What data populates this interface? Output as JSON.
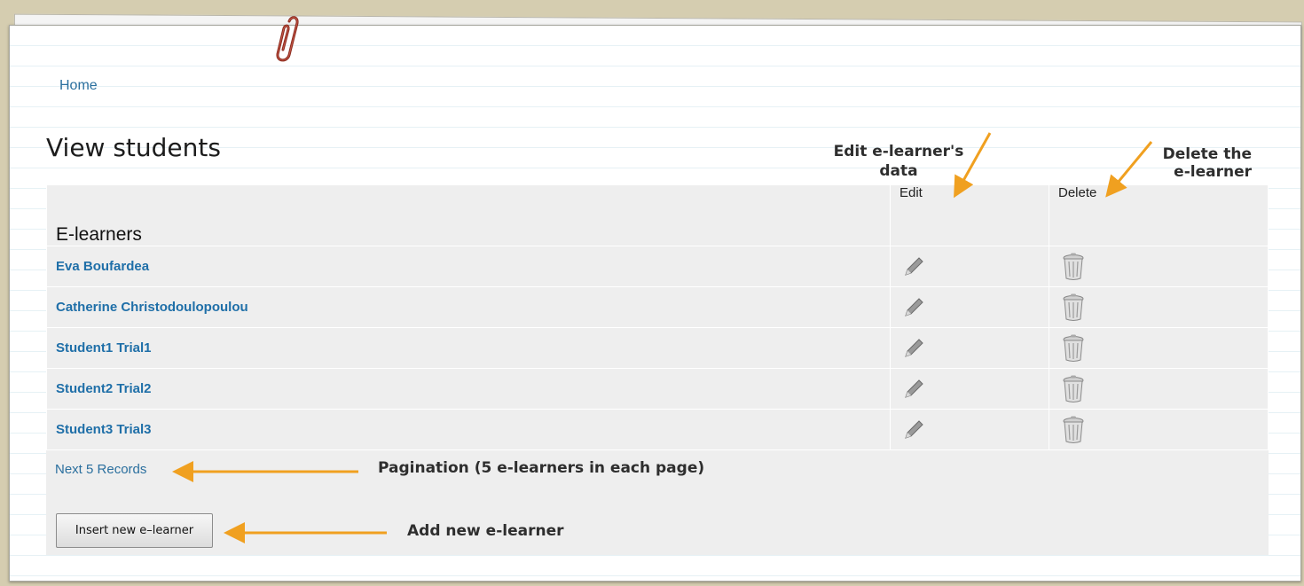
{
  "breadcrumb": {
    "home": "Home"
  },
  "page": {
    "title": "View students"
  },
  "table": {
    "headers": {
      "name": "E-learners",
      "edit": "Edit",
      "delete": "Delete"
    },
    "rows": [
      {
        "name": "Eva Boufardea"
      },
      {
        "name": "Catherine Christodoulopoulou"
      },
      {
        "name": "Student1 Trial1"
      },
      {
        "name": "Student2 Trial2"
      },
      {
        "name": "Student3 Trial3"
      }
    ]
  },
  "pagination": {
    "next_label": "Next 5 Records"
  },
  "actions": {
    "insert_label": "Insert new e–learner"
  },
  "annotations": {
    "edit_line1": "Edit e-learner's",
    "edit_line2": "data",
    "delete_line1": "Delete the",
    "delete_line2": "e-learner",
    "pagination": "Pagination (5 e-learners in each page)",
    "add": "Add new e-learner"
  },
  "icons": {
    "paperclip": "paperclip-icon",
    "edit": "pencil-icon",
    "delete": "trash-icon"
  },
  "colors": {
    "link": "#1f6fa8",
    "arrow": "#f0a020",
    "panel": "#eeeeee",
    "background": "#d5cdb0"
  }
}
